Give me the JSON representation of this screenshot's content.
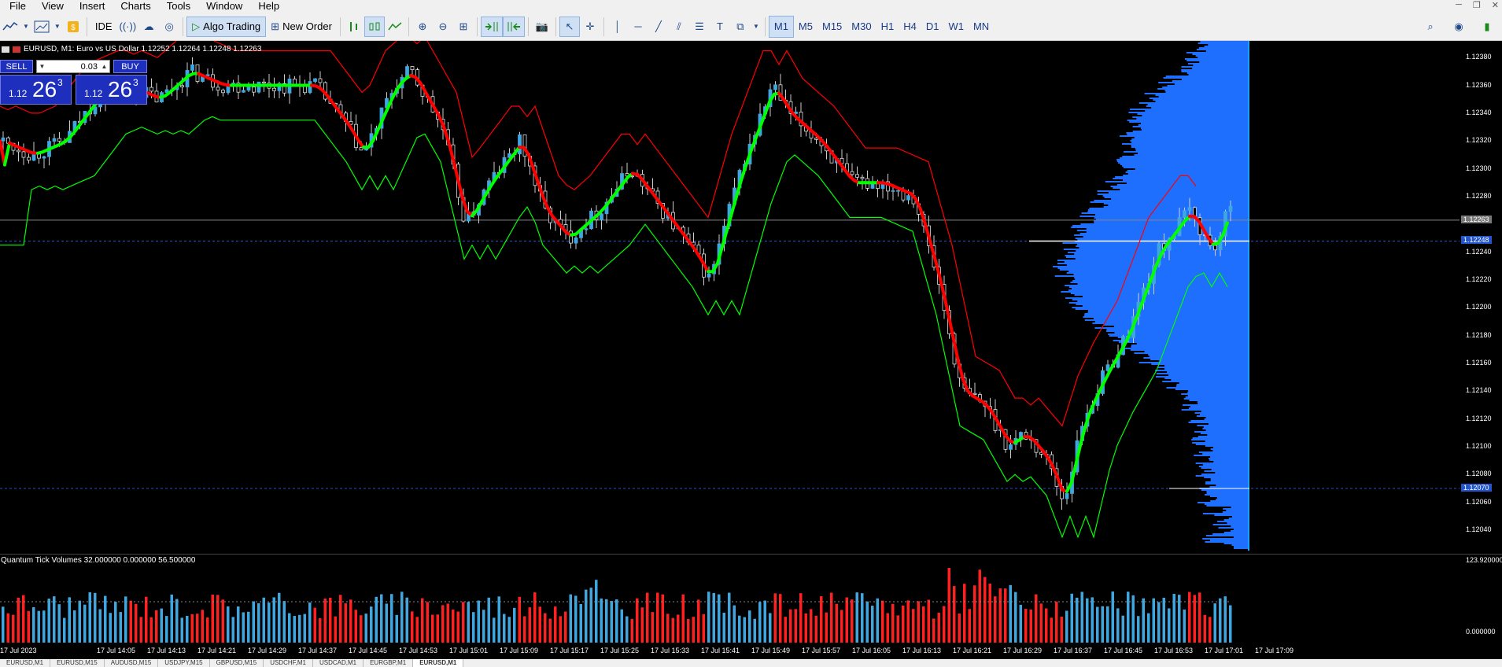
{
  "menu": [
    "File",
    "View",
    "Insert",
    "Charts",
    "Tools",
    "Window",
    "Help"
  ],
  "toolbar": {
    "ide": "IDE",
    "algo_trading": "Algo Trading",
    "new_order": "New Order",
    "timeframes": [
      "M1",
      "M5",
      "M15",
      "M30",
      "H1",
      "H4",
      "D1",
      "W1",
      "MN"
    ],
    "active_timeframe": "M1"
  },
  "chart": {
    "title": "EURUSD, M1:  Euro vs US Dollar  1.12252 1.12264 1.12248 1.12263",
    "trade_panel": {
      "sell": "SELL",
      "buy": "BUY",
      "lot": "0.03",
      "sell_price": {
        "small": "1.12",
        "big": "26",
        "sup": "3"
      },
      "buy_price": {
        "small": "1.12",
        "big": "26",
        "sup": "3"
      }
    },
    "price_axis": [
      "1.12380",
      "1.12360",
      "1.12340",
      "1.12320",
      "1.12300",
      "1.12280",
      "1.12240",
      "1.12220",
      "1.12200",
      "1.12180",
      "1.12160",
      "1.12140",
      "1.12120",
      "1.12100",
      "1.12080",
      "1.12060",
      "1.12040"
    ],
    "price_tags": {
      "bid": "1.12263",
      "current": "1.12248",
      "level": "1.12070"
    },
    "price_range": [
      1.12023,
      1.12392
    ],
    "colors": {
      "bull": "#3fa7e0",
      "bear": "#ff2020",
      "up_line": "#00ff00",
      "down_line": "#ff0000",
      "profile": "#1f6fff",
      "profile_edge": "#1aa0ff"
    }
  },
  "volume": {
    "title": "Quantum Tick Volumes 32.000000 0.000000 56.500000",
    "axis_max": "123.920000",
    "axis_min": "0.000000"
  },
  "time_axis": [
    "17 Jul 2023",
    "17 Jul 14:05",
    "17 Jul 14:13",
    "17 Jul 14:21",
    "17 Jul 14:29",
    "17 Jul 14:37",
    "17 Jul 14:45",
    "17 Jul 14:53",
    "17 Jul 15:01",
    "17 Jul 15:09",
    "17 Jul 15:17",
    "17 Jul 15:25",
    "17 Jul 15:33",
    "17 Jul 15:41",
    "17 Jul 15:49",
    "17 Jul 15:57",
    "17 Jul 16:05",
    "17 Jul 16:13",
    "17 Jul 16:21",
    "17 Jul 16:29",
    "17 Jul 16:37",
    "17 Jul 16:45",
    "17 Jul 16:53",
    "17 Jul 17:01",
    "17 Jul 17:09"
  ],
  "tabs": [
    "EURUSD,M1",
    "EURUSD,M15",
    "AUDUSD,M15",
    "USDJPY,M15",
    "GBPUSD,M15",
    "USDCHF,M1",
    "USDCAD,M1",
    "EURGBP,M1",
    "EURUSD,M1"
  ],
  "active_tab": 8
}
